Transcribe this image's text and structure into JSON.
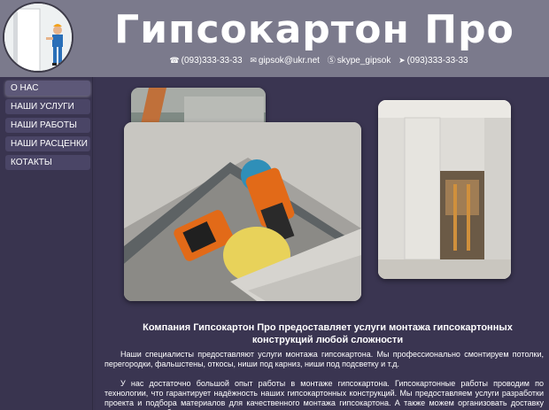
{
  "header": {
    "title": "Гипсокартон Про",
    "contacts": [
      {
        "icon": "phone-icon",
        "text": "(093)333-33-33"
      },
      {
        "icon": "envelope-icon",
        "text": "gipsok@ukr.net"
      },
      {
        "icon": "skype-icon",
        "text": "skype_gipsok"
      },
      {
        "icon": "send-icon",
        "text": "(093)333-33-33"
      }
    ]
  },
  "sidebar": {
    "items": [
      {
        "label": "О НАС",
        "active": true
      },
      {
        "label": "НАШИ УСЛУГИ",
        "active": false
      },
      {
        "label": "НАШИ РАБОТЫ",
        "active": false
      },
      {
        "label": "НАШИ РАСЦЕНКИ",
        "active": false
      },
      {
        "label": "КОТАКТЫ",
        "active": false
      }
    ]
  },
  "main": {
    "heading": "Компания Гипсокартон Про предоставляет услуги монтажа гипсокартонных конструкций любой сложности",
    "paragraphs": [
      "Наши специалисты предоставляют услуги монтажа гипсокартона. Мы профессионально смонтируем потолки, перегородки, фальшстены, откосы, ниши под карниз, ниши под подсветку и т.д.",
      "У нас достаточно большой опыт работы в монтаже гипсокартона. Гипсокартонные работы проводим по технологии, что гарантирует надёжность наших гипсокартонных конструкций. Мы предоставляем услуги разработки проекта и подбора материалов для качественного монтажа гипсокартона. А также можем организовать доставку материалов на объект."
    ]
  },
  "colors": {
    "header_bg": "#7b7a8c",
    "page_bg": "#3a3551",
    "nav_bg": "#4a4566",
    "text": "#ffffff"
  }
}
